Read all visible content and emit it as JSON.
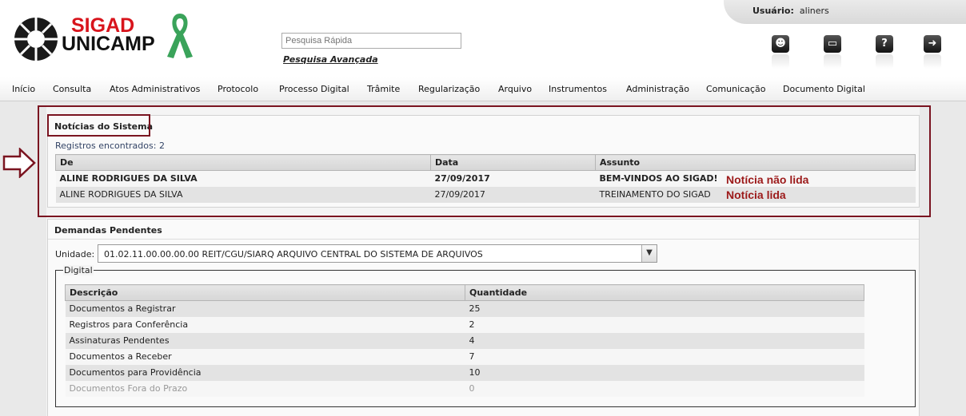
{
  "header": {
    "brand_line1": "SIGAD",
    "brand_line2": "UNICAMP",
    "search_placeholder": "Pesquisa Rápida",
    "advanced_search": "Pesquisa Avançada",
    "user_label": "Usuário:",
    "user_name": "aliners"
  },
  "menu": [
    "Início",
    "Consulta",
    "Atos Administrativos",
    "Protocolo",
    "Processo Digital",
    "Trâmite",
    "Regularização",
    "Arquivo",
    "Instrumentos",
    "Administração",
    "Comunicação",
    "Documento Digital"
  ],
  "news": {
    "title": "Notícias do Sistema",
    "count_text": "Registros encontrados: 2",
    "columns": [
      "De",
      "Data",
      "Assunto"
    ],
    "rows": [
      {
        "de": "ALINE RODRIGUES DA SILVA",
        "data": "27/09/2017",
        "assunto": "BEM-VINDOS AO SIGAD!",
        "note": "Notícia não lida"
      },
      {
        "de": "ALINE RODRIGUES DA SILVA",
        "data": "27/09/2017",
        "assunto": "TREINAMENTO DO SIGAD",
        "note": "Notícia lida"
      }
    ]
  },
  "demands": {
    "title": "Demandas Pendentes",
    "unit_label": "Unidade:",
    "unit_value": "01.02.11.00.00.00.00 REIT/CGU/SIARQ ARQUIVO CENTRAL DO SISTEMA DE ARQUIVOS",
    "fieldset_legend": "Digital",
    "columns": [
      "Descrição",
      "Quantidade"
    ],
    "rows": [
      {
        "desc": "Documentos a Registrar",
        "qty": "25"
      },
      {
        "desc": "Registros para Conferência",
        "qty": "2"
      },
      {
        "desc": "Assinaturas Pendentes",
        "qty": "4"
      },
      {
        "desc": "Documentos a Receber",
        "qty": "7"
      },
      {
        "desc": "Documentos para Providência",
        "qty": "10"
      },
      {
        "desc": "Documentos Fora do Prazo",
        "qty": "0"
      }
    ]
  },
  "colors": {
    "brand_red": "#d8141c",
    "highlight": "#7a1420",
    "note": "#9c1a1a",
    "ribbon": "#3aa35a"
  },
  "icons": [
    "person-icon",
    "chat-icon",
    "help-icon",
    "exit-icon"
  ]
}
